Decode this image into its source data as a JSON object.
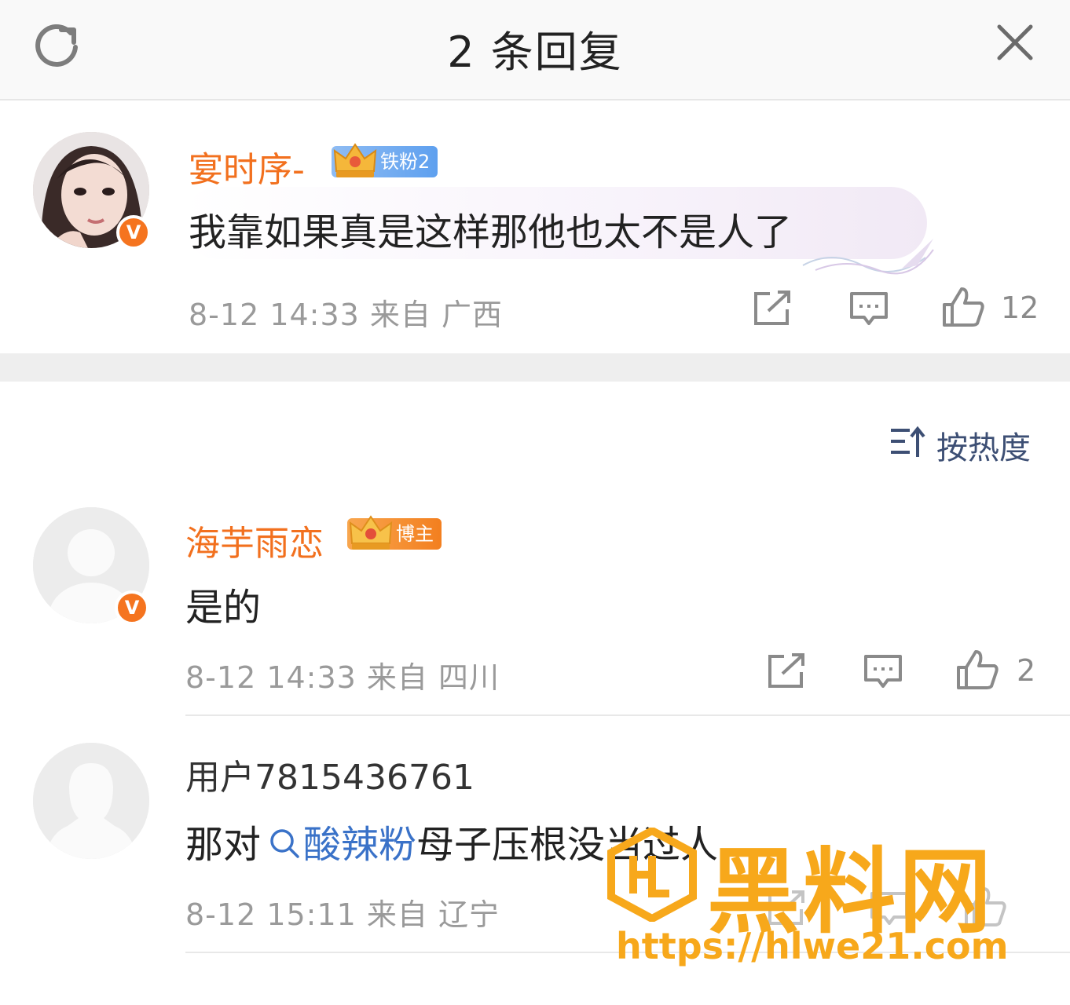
{
  "header": {
    "title": "2 条回复"
  },
  "root": {
    "username": "宴时序-",
    "fan_badge": "铁粉2",
    "text": "我靠如果真是这样那他也太不是人了",
    "meta": "8-12 14:33 来自 广西",
    "likes": "12"
  },
  "sort": {
    "label": "按热度"
  },
  "replies": [
    {
      "username": "海芋雨恋",
      "fan_badge": "博主",
      "text": "是的",
      "meta": "8-12 14:33 来自 四川",
      "likes": "2"
    },
    {
      "username": "用户7815436761",
      "text_before": "那对",
      "topic": "酸辣粉",
      "text_after": "母子压根没当过人",
      "meta": "8-12 15:11 来自 辽宁"
    }
  ],
  "watermark": {
    "text": "黑料网",
    "url": "https://hlwe21.com"
  },
  "colors": {
    "username_orange": "#f2701e",
    "topic_blue": "#3a72c8",
    "vip_orange": "#f5741f",
    "watermark": "#f7a81b"
  },
  "icons": [
    "refresh-icon",
    "close-icon",
    "share-icon",
    "comment-icon",
    "like-icon",
    "sort-icon",
    "search-icon",
    "crown-icon"
  ]
}
